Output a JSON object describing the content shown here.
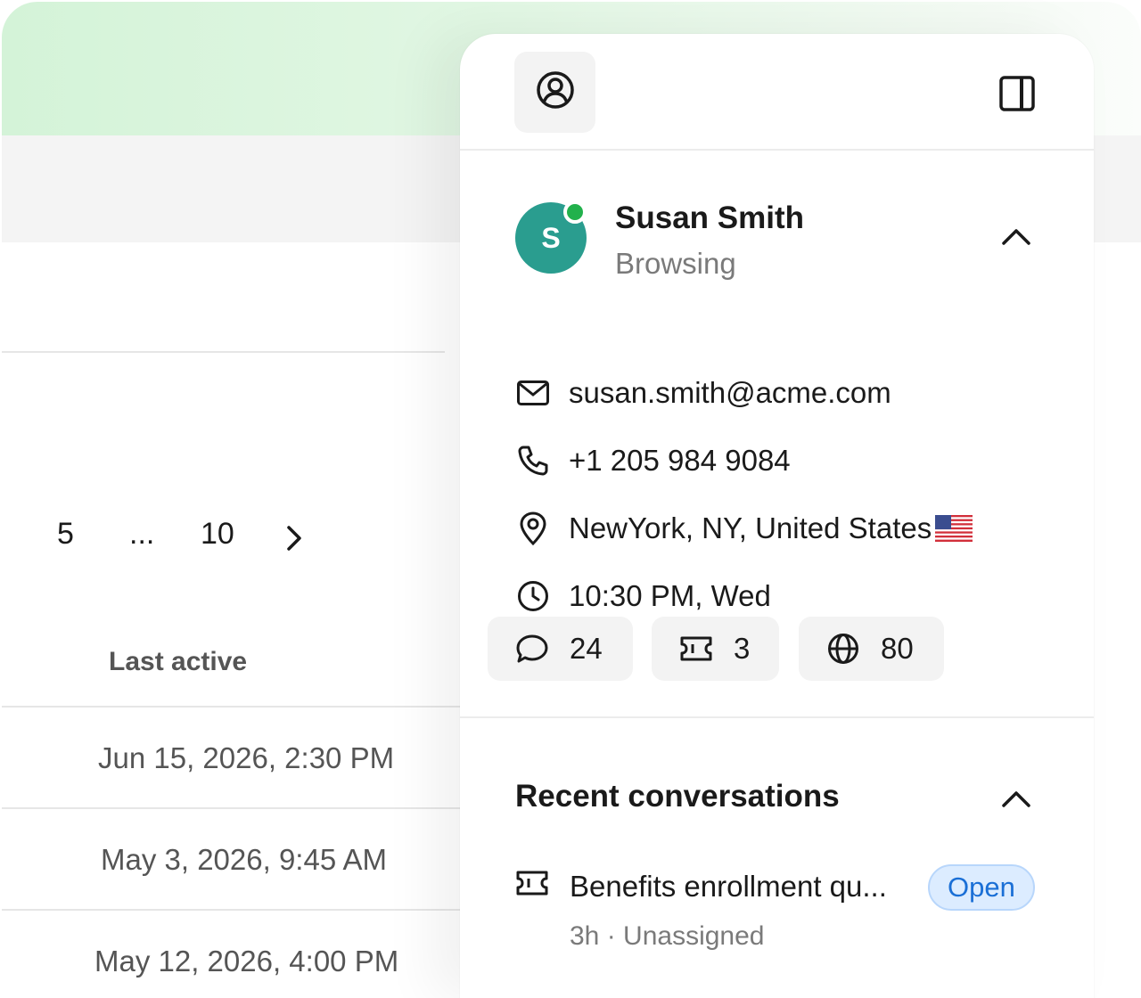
{
  "table": {
    "pagination": {
      "page_a": "5",
      "ellipsis": "...",
      "page_b": "10"
    },
    "column_header": "Last active",
    "rows": [
      {
        "last_active": "Jun 15, 2026, 2:30 PM"
      },
      {
        "last_active": "May 3, 2026, 9:45 AM"
      },
      {
        "last_active": "May 12, 2026, 4:00 PM"
      }
    ]
  },
  "contact": {
    "initial": "S",
    "name": "Susan Smith",
    "status": "Browsing",
    "email": "susan.smith@acme.com",
    "phone": "+1 205 984 9084",
    "location": "NewYork, NY, United States",
    "local_time": "10:30 PM, Wed",
    "stats": {
      "conversations": "24",
      "tickets": "3",
      "visits": "80"
    },
    "avatar_color": "#2a9d8f",
    "presence_color": "#22b14c"
  },
  "recent": {
    "title": "Recent conversations",
    "items": [
      {
        "title": "Benefits enrollment qu...",
        "status": "Open",
        "meta": "3h · Unassigned"
      }
    ]
  }
}
